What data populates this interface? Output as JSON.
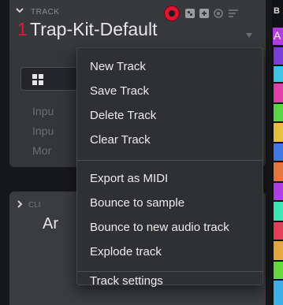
{
  "track": {
    "header_label": "TRACK",
    "number": "1",
    "name": "Trap-Kit-Default"
  },
  "side_labels": [
    "Inpu",
    "Inpu",
    "Mor"
  ],
  "clip": {
    "header_label": "CLI",
    "name": "Ar"
  },
  "edge": {
    "top_letter": "B",
    "a_letter": "A"
  },
  "menu": {
    "groups": [
      [
        "New Track",
        "Save Track",
        "Delete Track",
        "Clear Track"
      ],
      [
        "Export as MIDI",
        "Bounce to sample",
        "Bounce to new audio track",
        "Explode track"
      ],
      [
        "Track settings"
      ]
    ]
  },
  "colors": {
    "accent_red": "#e8182e",
    "record": "#e0142e",
    "menu_bg": "#2e3033",
    "panel_bg": "#34363a"
  }
}
